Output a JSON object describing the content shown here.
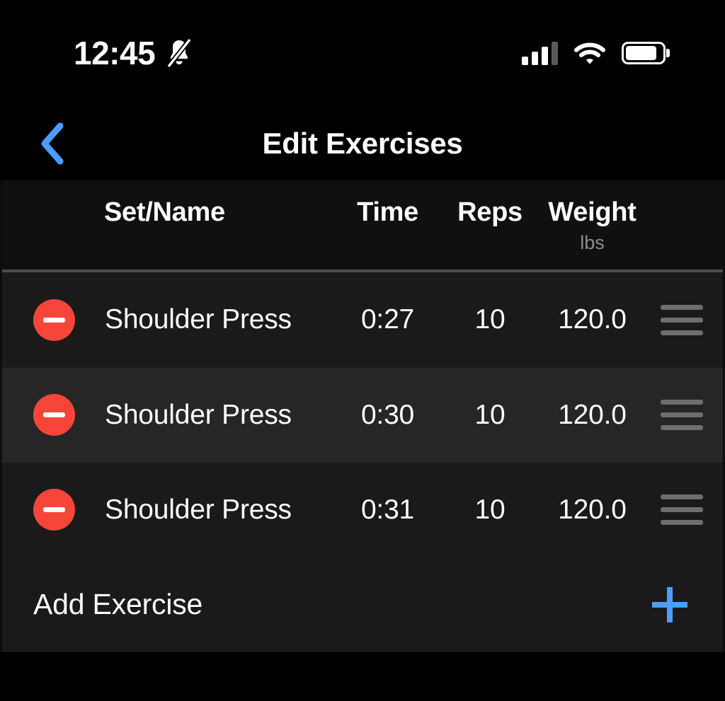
{
  "status_bar": {
    "time": "12:45",
    "mute_icon": "bell-slash-icon",
    "signal_icon": "cellular-signal-icon",
    "signal_bars_active": 3,
    "signal_bars_total": 4,
    "wifi_icon": "wifi-icon",
    "battery_icon": "battery-icon",
    "battery_level_percent": 85
  },
  "nav": {
    "back_icon": "chevron-left-icon",
    "title": "Edit Exercises",
    "accent_color": "#4a9eff"
  },
  "table": {
    "headers": {
      "name": "Set/Name",
      "time": "Time",
      "reps": "Reps",
      "weight": "Weight",
      "weight_unit": "lbs"
    },
    "rows": [
      {
        "delete_icon": "minus-circle-icon",
        "name": "Shoulder Press",
        "time": "0:27",
        "reps": "10",
        "weight": "120.0",
        "handle_icon": "drag-handle-icon"
      },
      {
        "delete_icon": "minus-circle-icon",
        "name": "Shoulder Press",
        "time": "0:30",
        "reps": "10",
        "weight": "120.0",
        "handle_icon": "drag-handle-icon"
      },
      {
        "delete_icon": "minus-circle-icon",
        "name": "Shoulder Press",
        "time": "0:31",
        "reps": "10",
        "weight": "120.0",
        "handle_icon": "drag-handle-icon"
      }
    ]
  },
  "add_exercise": {
    "label": "Add Exercise",
    "plus_icon": "plus-icon"
  },
  "colors": {
    "delete_red": "#f8453a",
    "accent_blue": "#4a9eff",
    "row_odd": "#1a1a1a",
    "row_even": "#262626",
    "header_bg": "#101010",
    "text_secondary": "#8d8d8d"
  }
}
